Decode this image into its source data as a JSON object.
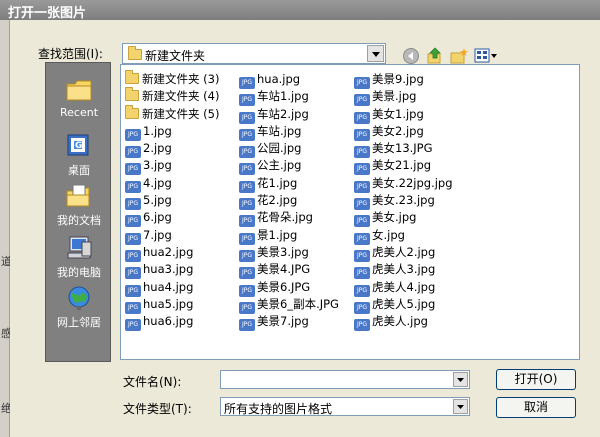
{
  "window": {
    "title": "打开一张图片"
  },
  "look_in": {
    "label": "查找范围(I):",
    "value": "新建文件夹"
  },
  "toolbar_icons": [
    "back-icon",
    "up-folder-icon",
    "new-folder-icon",
    "view-menu-icon"
  ],
  "places": [
    {
      "label": "Recent",
      "icon": "recent-folder-icon"
    },
    {
      "label": "桌面",
      "icon": "desktop-icon"
    },
    {
      "label": "我的文档",
      "icon": "my-documents-icon"
    },
    {
      "label": "我的电脑",
      "icon": "my-computer-icon"
    },
    {
      "label": "网上邻居",
      "icon": "network-icon"
    }
  ],
  "files": {
    "col1": [
      {
        "name": "新建文件夹 (3)",
        "type": "folder"
      },
      {
        "name": "新建文件夹 (4)",
        "type": "folder"
      },
      {
        "name": "新建文件夹 (5)",
        "type": "folder"
      },
      {
        "name": "1.jpg",
        "type": "jpg"
      },
      {
        "name": "2.jpg",
        "type": "jpg"
      },
      {
        "name": "3.jpg",
        "type": "jpg"
      },
      {
        "name": "4.jpg",
        "type": "jpg"
      },
      {
        "name": "5.jpg",
        "type": "jpg"
      },
      {
        "name": "6.jpg",
        "type": "jpg"
      },
      {
        "name": "7.jpg",
        "type": "jpg"
      },
      {
        "name": "hua2.jpg",
        "type": "jpg"
      },
      {
        "name": "hua3.jpg",
        "type": "jpg"
      },
      {
        "name": "hua4.jpg",
        "type": "jpg"
      },
      {
        "name": "hua5.jpg",
        "type": "jpg"
      },
      {
        "name": "hua6.jpg",
        "type": "jpg"
      }
    ],
    "col2": [
      {
        "name": "hua.jpg",
        "type": "jpg"
      },
      {
        "name": "车站1.jpg",
        "type": "jpg"
      },
      {
        "name": "车站2.jpg",
        "type": "jpg"
      },
      {
        "name": "车站.jpg",
        "type": "jpg"
      },
      {
        "name": "公园.jpg",
        "type": "jpg"
      },
      {
        "name": "公主.jpg",
        "type": "jpg"
      },
      {
        "name": "花1.jpg",
        "type": "jpg"
      },
      {
        "name": "花2.jpg",
        "type": "jpg"
      },
      {
        "name": "花骨朵.jpg",
        "type": "jpg"
      },
      {
        "name": "景1.jpg",
        "type": "jpg"
      },
      {
        "name": "美景3.jpg",
        "type": "jpg"
      },
      {
        "name": "美景4.JPG",
        "type": "jpg"
      },
      {
        "name": "美景6.JPG",
        "type": "jpg"
      },
      {
        "name": "美景6_副本.JPG",
        "type": "jpg"
      },
      {
        "name": "美景7.jpg",
        "type": "jpg"
      }
    ],
    "col3": [
      {
        "name": "美景9.jpg",
        "type": "jpg"
      },
      {
        "name": "美景.jpg",
        "type": "jpg"
      },
      {
        "name": "美女1.jpg",
        "type": "jpg"
      },
      {
        "name": "美女2.jpg",
        "type": "jpg"
      },
      {
        "name": "美女13.JPG",
        "type": "jpg"
      },
      {
        "name": "美女21.jpg",
        "type": "jpg"
      },
      {
        "name": "美女.22jpg.jpg",
        "type": "jpg"
      },
      {
        "name": "美女.23.jpg",
        "type": "jpg"
      },
      {
        "name": "美女.jpg",
        "type": "jpg"
      },
      {
        "name": "女.jpg",
        "type": "jpg"
      },
      {
        "name": "虎美人2.jpg",
        "type": "jpg"
      },
      {
        "name": "虎美人3.jpg",
        "type": "jpg"
      },
      {
        "name": "虎美人4.jpg",
        "type": "jpg"
      },
      {
        "name": "虎美人5.jpg",
        "type": "jpg"
      },
      {
        "name": "虎美人.jpg",
        "type": "jpg"
      }
    ]
  },
  "file_name": {
    "label": "文件名(N):",
    "value": ""
  },
  "file_type": {
    "label": "文件类型(T):",
    "value": "所有支持的图片格式"
  },
  "buttons": {
    "open": "打开(O)",
    "cancel": "取消"
  },
  "file_icon_text": "JPG"
}
